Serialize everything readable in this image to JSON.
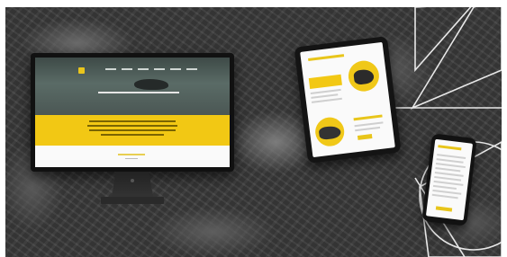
{
  "scene": {
    "devices": {
      "desktop": {
        "kind": "desktop-monitor",
        "hero_brand_color": "#e9c51c",
        "band_color": "#f2c814"
      },
      "tablet": {
        "kind": "tablet",
        "accent_color": "#e8c51a"
      },
      "phone": {
        "kind": "phone",
        "accent_color": "#e8c51a"
      }
    },
    "background": {
      "kind": "grayscale aerial rocky terrain",
      "overlay_line_color": "#e8e8e8"
    },
    "icons": [
      "desktop-monitor-icon",
      "tablet-icon",
      "phone-icon",
      "triangle-outline",
      "circle-outline"
    ]
  }
}
